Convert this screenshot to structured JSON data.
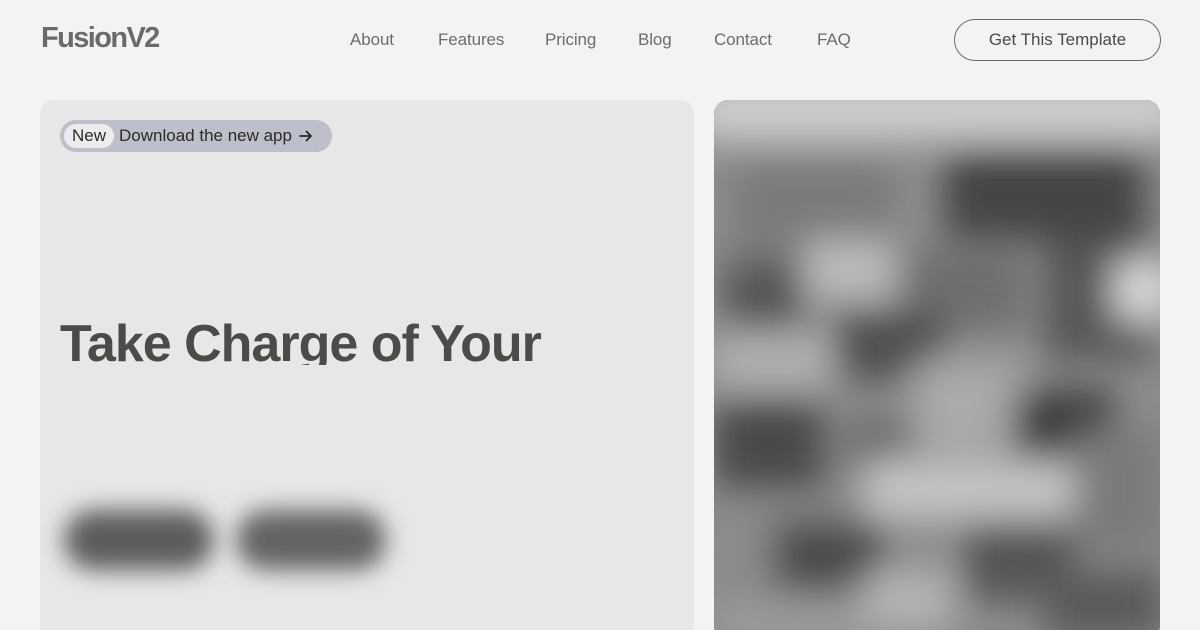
{
  "brand": {
    "logo_text": "FusionV2"
  },
  "nav": {
    "items": [
      "About",
      "Features",
      "Pricing",
      "Blog",
      "Contact",
      "FAQ"
    ]
  },
  "header": {
    "cta_label": "Get This Template"
  },
  "hero": {
    "badge": {
      "tag": "New",
      "text": "Download the new app",
      "icon": "arrow-right-icon"
    },
    "headline": "Take Charge of Your"
  },
  "media": {
    "icon": "blurred-image"
  },
  "colors": {
    "background": "#f3f3f2",
    "card": "#e7e7e7",
    "badge_bg": "#bdbfcb",
    "text": "#4b4b48"
  }
}
